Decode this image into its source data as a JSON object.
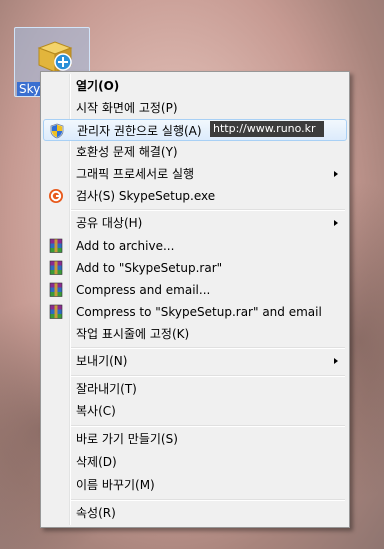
{
  "desktop": {
    "icon_label": "Sky",
    "url_overlay": "http://www.runo.kr"
  },
  "menu": {
    "items": [
      {
        "label": "열기(O)",
        "bold": true,
        "icon": "",
        "submenu": false
      },
      {
        "label": "시작 화면에 고정(P)",
        "icon": "",
        "submenu": false
      },
      {
        "label": "관리자 권한으로 실행(A)",
        "icon": "uac-shield-icon",
        "submenu": false,
        "highlighted": true
      },
      {
        "label": "호환성 문제 해결(Y)",
        "icon": "",
        "submenu": false
      },
      {
        "label": "그래픽 프로세서로 실행",
        "icon": "",
        "submenu": true
      },
      {
        "label": "검사(S) SkypeSetup.exe",
        "icon": "antivirus-icon",
        "submenu": false
      },
      {
        "label": "공유 대상(H)",
        "icon": "",
        "submenu": true
      },
      {
        "label": "Add to archive...",
        "icon": "winrar-icon",
        "submenu": false
      },
      {
        "label": "Add to \"SkypeSetup.rar\"",
        "icon": "winrar-icon",
        "submenu": false
      },
      {
        "label": "Compress and email...",
        "icon": "winrar-icon",
        "submenu": false
      },
      {
        "label": "Compress to \"SkypeSetup.rar\" and email",
        "icon": "winrar-icon",
        "submenu": false
      },
      {
        "label": "작업 표시줄에 고정(K)",
        "icon": "",
        "submenu": false
      },
      {
        "label": "보내기(N)",
        "icon": "",
        "submenu": true
      },
      {
        "label": "잘라내기(T)",
        "icon": "",
        "submenu": false
      },
      {
        "label": "복사(C)",
        "icon": "",
        "submenu": false
      },
      {
        "label": "바로 가기 만들기(S)",
        "icon": "",
        "submenu": false
      },
      {
        "label": "삭제(D)",
        "icon": "",
        "submenu": false
      },
      {
        "label": "이름 바꾸기(M)",
        "icon": "",
        "submenu": false
      },
      {
        "label": "속성(R)",
        "icon": "",
        "submenu": false
      }
    ]
  },
  "colors": {
    "highlight_border": "#a8d0f5",
    "menu_background": "#f0f0f0",
    "url_box_background": "#3c3c3c"
  }
}
